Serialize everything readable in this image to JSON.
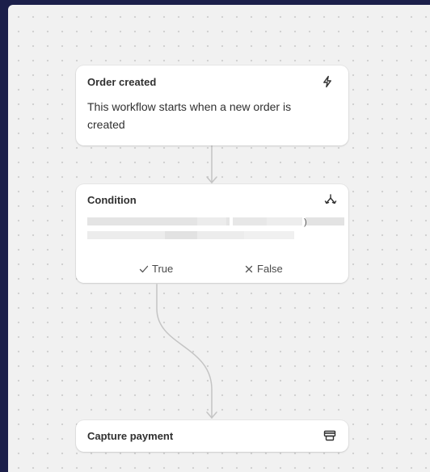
{
  "workflow": {
    "trigger": {
      "title": "Order created",
      "icon": "lightning-bolt-icon",
      "description": "This workflow starts when a new order is created"
    },
    "condition": {
      "title": "Condition",
      "icon": "branch-fork-icon",
      "trailing_char": ")",
      "branches": {
        "true_label": "True",
        "true_icon": "checkmark-icon",
        "false_label": "False",
        "false_icon": "x-icon"
      }
    },
    "action": {
      "title": "Capture payment",
      "icon": "credit-card-icon"
    }
  },
  "colors": {
    "frame_background": "#1c1f4a",
    "canvas_background": "#f1f1f1",
    "connector": "#c4c4c4",
    "text": "#303030"
  }
}
